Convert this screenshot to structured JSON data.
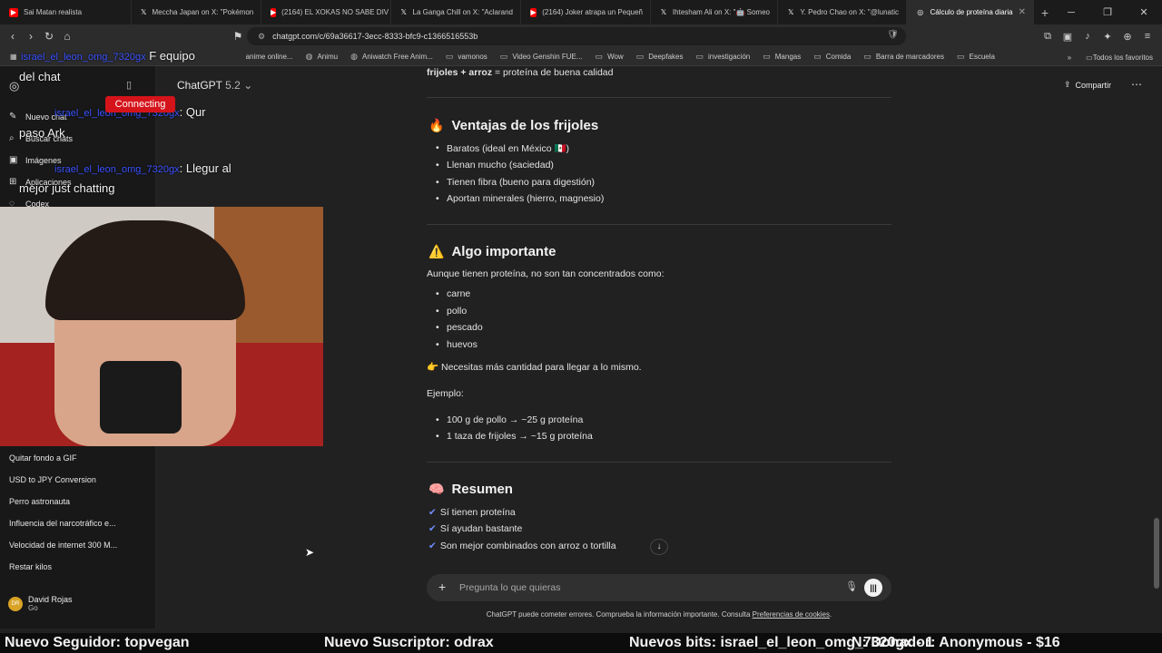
{
  "browser": {
    "tabs": [
      {
        "label": "Sai Matan realista",
        "icon": "youtube-icon",
        "color": "#ff0000"
      },
      {
        "label": "Meccha Japan on X: \"Pokémon",
        "icon": "x-icon",
        "color": "#000000"
      },
      {
        "label": "(2164) EL XOKAS NO SABE DIV",
        "icon": "youtube-icon",
        "color": "#ff0000"
      },
      {
        "label": "La Ganga Chill on X: \"Aclarand",
        "icon": "x-icon",
        "color": "#000000"
      },
      {
        "label": "(2164) Joker atrapa un Pequeñ",
        "icon": "youtube-icon",
        "color": "#ff0000"
      },
      {
        "label": "Ihtesham Ali on X: \"🤖 Someo",
        "icon": "x-icon",
        "color": "#000000"
      },
      {
        "label": "Y. Pedro Chao on X: \"@lunatic",
        "icon": "x-icon",
        "color": "#000000"
      },
      {
        "label": "Cálculo de proteína diaria",
        "icon": "chatgpt-icon",
        "color": "#ffffff",
        "active": true
      }
    ],
    "url": "chatgpt.com/c/69a36617-3ecc-8333-bfc9-c1366516553b",
    "bookmarks": [
      "anime online...",
      "Animu",
      "Aniwatch Free Anim...",
      "vamonos",
      "Video Genshin FUE...",
      "Wow",
      "Deepfakes",
      "investigación",
      "Mangas",
      "Comida",
      "Barra de marcadores",
      "Escuela"
    ],
    "bookmarks_all": "Todos los favoritos"
  },
  "sidebar": {
    "new_chat": "Nuevo chat",
    "search": "Buscar chats",
    "images": "Imágenes",
    "apps": "Aplicaciones",
    "codex": "Codex",
    "chats": [
      "Quitar fondo a GIF",
      "USD to JPY Conversion",
      "Perro astronauta",
      "Influencia del narcotráfico e...",
      "Velocidad de internet 300 M...",
      "Restar kilos"
    ],
    "user": {
      "name": "David Rojas",
      "plan": "Go",
      "initials": "DR"
    }
  },
  "header": {
    "model": "ChatGPT",
    "version": "5.2",
    "share": "Compartir"
  },
  "message": {
    "top_line_bold": "frijoles + arroz",
    "top_line_rest": " = proteína de buena calidad",
    "section1": {
      "emoji": "🔥",
      "title": "Ventajas de los frijoles",
      "items": [
        "Baratos (ideal en México 🇲🇽)",
        "Llenan mucho (saciedad)",
        "Tienen fibra (bueno para digestión)",
        "Aportan minerales (hierro, magnesio)"
      ]
    },
    "section2": {
      "emoji": "⚠️",
      "title": "Algo importante",
      "intro": "Aunque tienen proteína, no son tan concentrados como:",
      "items": [
        "carne",
        "pollo",
        "pescado",
        "huevos"
      ],
      "note": "👉 Necesitas más cantidad para llegar a lo mismo.",
      "example_label": "Ejemplo:",
      "examples": [
        "100 g de pollo → ~25 g proteína",
        "1 taza de frijoles → ~15 g proteína"
      ]
    },
    "section3": {
      "emoji": "🧠",
      "title": "Resumen",
      "checks": [
        "Sí tienen proteína",
        "Sí ayudan bastante",
        "Son mejor combinados con arroz o tortilla"
      ]
    }
  },
  "composer": {
    "placeholder": "Pregunta lo que quieras",
    "disclaimer": "ChatGPT puede cometer errores. Comprueba la información importante. Consulta ",
    "disclaimer_link": "Preferencias de cookies",
    "disclaimer_end": "."
  },
  "stream": {
    "connecting": "Connecting",
    "chat_lines": [
      {
        "user": "israel_el_leon_omg_7320gx",
        "text": "F equipo"
      },
      {
        "user": "",
        "text": "del chat"
      },
      {
        "user": "israel_el_leon_omg_7320gx",
        "text": ": Qur"
      },
      {
        "user": "",
        "text": "paso Ark"
      },
      {
        "user": "israel_el_leon_omg_7320gx",
        "text": ": Llegur al"
      },
      {
        "user": "",
        "text": "mejor just chatting"
      }
    ],
    "alerts": {
      "follower": "Nuevo Seguidor: topvegan",
      "subscriber": "Nuevo Suscriptor: odrax",
      "bits": "Nuevos bits: israel_el_leon_omg_7320gx - 1",
      "donor": "N: Donador: Anonymous - $16"
    }
  }
}
